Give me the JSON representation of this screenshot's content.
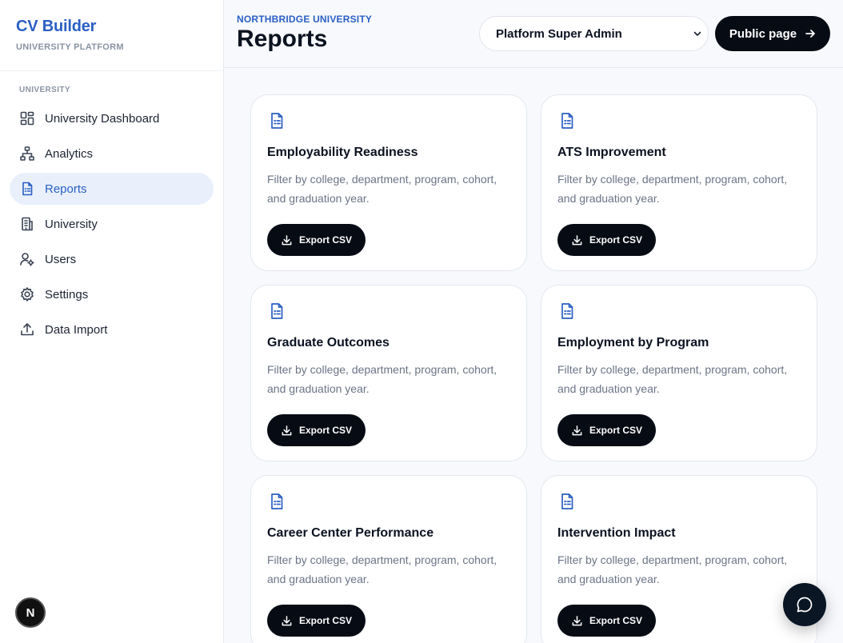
{
  "sidebar": {
    "brand_title": "CV Builder",
    "brand_subtitle": "UNIVERSITY PLATFORM",
    "section_label": "UNIVERSITY",
    "items": [
      {
        "label": "University Dashboard",
        "icon": "dashboard-icon",
        "active": false
      },
      {
        "label": "Analytics",
        "icon": "hierarchy-icon",
        "active": false
      },
      {
        "label": "Reports",
        "icon": "document-icon",
        "active": true
      },
      {
        "label": "University",
        "icon": "building-icon",
        "active": false
      },
      {
        "label": "Users",
        "icon": "user-gear-icon",
        "active": false
      },
      {
        "label": "Settings",
        "icon": "gear-icon",
        "active": false
      },
      {
        "label": "Data Import",
        "icon": "upload-icon",
        "active": false
      }
    ],
    "avatar_initial": "N"
  },
  "header": {
    "university_label": "NORTHBRIDGE UNIVERSITY",
    "title": "Reports",
    "role_select_value": "Platform Super Admin",
    "public_page_label": "Public page"
  },
  "reports": [
    {
      "title": "Employability Readiness",
      "description": "Filter by college, department, program, cohort, and graduation year.",
      "button": "Export CSV"
    },
    {
      "title": "ATS Improvement",
      "description": "Filter by college, department, program, cohort, and graduation year.",
      "button": "Export CSV"
    },
    {
      "title": "Graduate Outcomes",
      "description": "Filter by college, department, program, cohort, and graduation year.",
      "button": "Export CSV"
    },
    {
      "title": "Employment by Program",
      "description": "Filter by college, department, program, cohort, and graduation year.",
      "button": "Export CSV"
    },
    {
      "title": "Career Center Performance",
      "description": "Filter by college, department, program, cohort, and graduation year.",
      "button": "Export CSV"
    },
    {
      "title": "Intervention Impact",
      "description": "Filter by college, department, program, cohort, and graduation year.",
      "button": "Export CSV"
    }
  ],
  "colors": {
    "accent": "#2b5fc4",
    "active_bg": "#e9f0fc",
    "button_dark": "#070b14"
  }
}
